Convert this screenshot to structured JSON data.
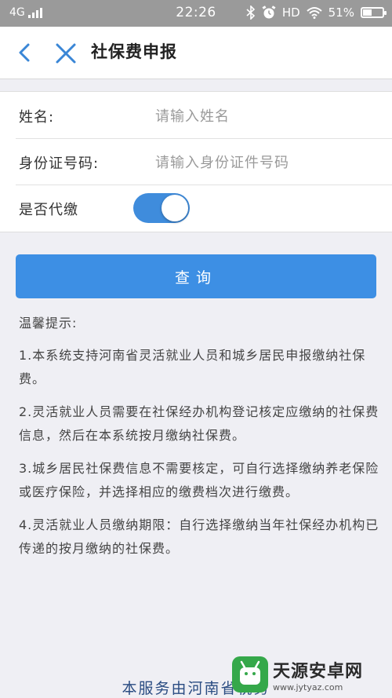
{
  "status_bar": {
    "network": "4G",
    "time": "22:26",
    "hd": "HD",
    "battery": "51%",
    "battery_level": 0.51
  },
  "nav": {
    "title": "社保费申报",
    "back_icon": "chevron-left-icon",
    "close_icon": "close-icon"
  },
  "form": {
    "name": {
      "label": "姓名:",
      "placeholder": "请输入姓名",
      "value": ""
    },
    "id_number": {
      "label": "身份证号码:",
      "placeholder": "请输入身份证件号码",
      "value": ""
    },
    "proxy_pay": {
      "label": "是否代缴",
      "on": true
    }
  },
  "query_button": "查询",
  "tips": {
    "title": "温馨提示:",
    "items": [
      "1.本系统支持河南省灵活就业人员和城乡居民申报缴纳社保费。",
      "2.灵活就业人员需要在社保经办机构登记核定应缴纳的社保费信息，然后在本系统按月缴纳社保费。",
      "3.城乡居民社保费信息不需要核定，可自行选择缴纳养老保险或医疗保险，并选择相应的缴费档次进行缴费。",
      "4.灵活就业人员缴纳期限：自行选择缴纳当年社保经办机构已传递的按月缴纳的社保费。"
    ]
  },
  "footer": "本服务由河南省税务",
  "watermark": {
    "name": "天源安卓网",
    "url": "www.jytyaz.com"
  },
  "colors": {
    "accent": "#3d8fe4",
    "toggle_on": "#3f8cdc",
    "footer_text": "#2a4c82"
  }
}
